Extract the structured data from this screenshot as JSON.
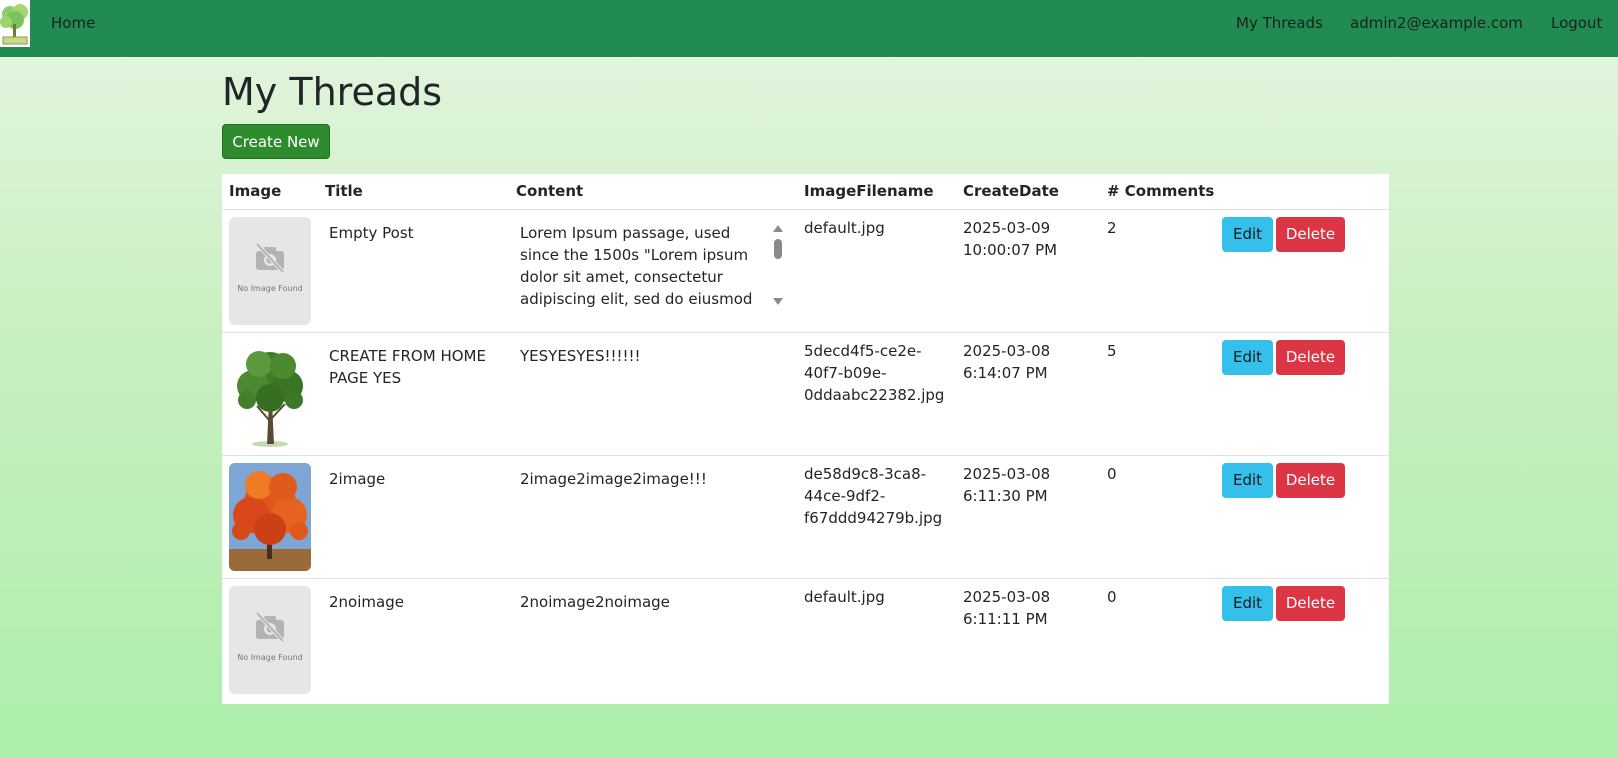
{
  "nav": {
    "home": "Home",
    "my_threads": "My Threads",
    "user_email": "admin2@example.com",
    "logout": "Logout"
  },
  "page_title": "My Threads",
  "create_button": "Create New",
  "table": {
    "headers": {
      "image": "Image",
      "title": "Title",
      "content": "Content",
      "filename": "ImageFilename",
      "createdate": "CreateDate",
      "comments": "# Comments"
    },
    "no_image_text": "No Image Found",
    "edit_label": "Edit",
    "delete_label": "Delete",
    "rows": [
      {
        "image": "no-image",
        "title": "Empty Post",
        "content": "Lorem Ipsum passage, used since the 1500s \"Lorem ipsum dolor sit amet, consectetur adipiscing elit, sed do eiusmod tempor",
        "filename": "default.jpg",
        "createdate": "2025-03-09 10:00:07 PM",
        "comments": "2"
      },
      {
        "image": "green-tree",
        "title": "CREATE FROM HOME PAGE YES",
        "content": "YESYESYES!!!!!!",
        "filename": "5decd4f5-ce2e-40f7-b09e-0ddaabc22382.jpg",
        "createdate": "2025-03-08 6:14:07 PM",
        "comments": "5"
      },
      {
        "image": "autumn-tree",
        "title": "2image",
        "content": "2image2image2image!!!",
        "filename": "de58d9c8-3ca8-44ce-9df2-f67ddd94279b.jpg",
        "createdate": "2025-03-08 6:11:30 PM",
        "comments": "0"
      },
      {
        "image": "no-image",
        "title": "2noimage",
        "content": "2noimage2noimage",
        "filename": "default.jpg",
        "createdate": "2025-03-08 6:11:11 PM",
        "comments": "0"
      }
    ]
  },
  "colors": {
    "navbar": "#228b52",
    "create_button": "#2e8b2e",
    "edit_button": "#34c0eb",
    "delete_button": "#dc3545"
  }
}
